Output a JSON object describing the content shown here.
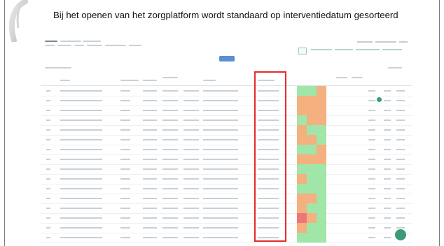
{
  "slide": {
    "caption": "Bij het openen van het zorgplatform wordt standaard op interventiedatum gesorteerd"
  },
  "colors": {
    "highlight_border": "#e52b2b",
    "status_ok": "#9fe6a8",
    "status_warning": "#f4b07f",
    "status_bad": "#f07676",
    "accent": "#3c9a77",
    "filter_chip": "#5b8fd1"
  },
  "screenshot": {
    "rows": [
      [
        "ok",
        "ok",
        "warn"
      ],
      [
        "warn",
        "warn",
        "warn"
      ],
      [
        "warn",
        "warn",
        "warn"
      ],
      [
        "ok",
        "warn",
        "warn"
      ],
      [
        "warn",
        "ok",
        "ok"
      ],
      [
        "warn",
        "warn",
        "ok"
      ],
      [
        "ok",
        "ok",
        "warn"
      ],
      [
        "warn",
        "warn",
        "warn"
      ],
      [
        "ok",
        "ok",
        "ok"
      ],
      [
        "warn",
        "ok",
        "ok"
      ],
      [
        "ok",
        "ok",
        "ok"
      ],
      [
        "warn",
        "warn",
        "ok"
      ],
      [
        "warn",
        "ok",
        "ok"
      ],
      [
        "bad",
        "warn",
        "ok"
      ],
      [
        "warn",
        "ok",
        "ok"
      ],
      [
        "ok",
        "ok",
        "ok"
      ]
    ],
    "icons": {
      "fab": "plus-icon",
      "small_fab": "settings-icon",
      "decor": "stethoscope-icon"
    }
  }
}
